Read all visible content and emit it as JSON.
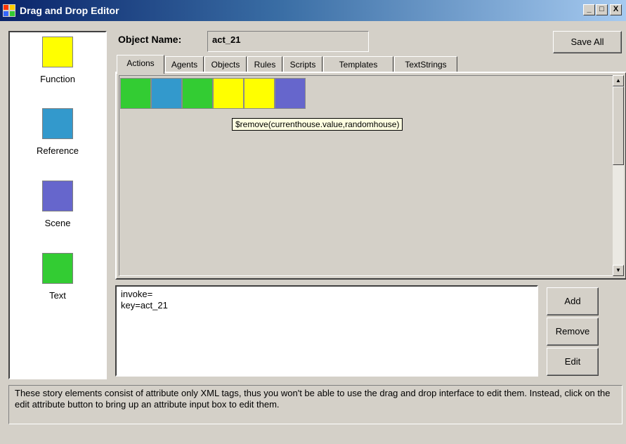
{
  "window": {
    "title": "Drag and Drop Editor",
    "controls": {
      "minimize": "_",
      "maximize": "□",
      "close": "X"
    }
  },
  "palette": {
    "items": [
      {
        "label": "Function",
        "color": "#ffff00"
      },
      {
        "label": "Reference",
        "color": "#3399cc"
      },
      {
        "label": "Scene",
        "color": "#6666cc"
      },
      {
        "label": "Text",
        "color": "#33cc33"
      }
    ]
  },
  "object": {
    "label": "Object Name:",
    "value": "act_21"
  },
  "toolbar": {
    "save_all": "Save All"
  },
  "tabs": [
    {
      "label": "Actions",
      "active": true
    },
    {
      "label": "Agents"
    },
    {
      "label": "Objects"
    },
    {
      "label": "Rules"
    },
    {
      "label": "Scripts"
    },
    {
      "label": "Templates"
    },
    {
      "label": "TextStrings"
    }
  ],
  "canvas": {
    "blocks": [
      {
        "type": "Text",
        "color": "#33cc33"
      },
      {
        "type": "Reference",
        "color": "#3399cc"
      },
      {
        "type": "Text",
        "color": "#33cc33"
      },
      {
        "type": "Function",
        "color": "#ffff00"
      },
      {
        "type": "Function",
        "color": "#ffff00"
      },
      {
        "type": "Scene",
        "color": "#6666cc"
      }
    ],
    "tooltip": "$remove(currenthouse.value,randomhouse)"
  },
  "attributes": {
    "lines": [
      "invoke=",
      "key=act_21"
    ]
  },
  "attr_buttons": {
    "add": "Add",
    "remove": "Remove",
    "edit": "Edit"
  },
  "info": "These story elements consist of attribute only XML tags, thus you won't be able to use the drag and drop interface to edit them. Instead, click on the edit attribute button to bring up an attribute input box to edit them."
}
